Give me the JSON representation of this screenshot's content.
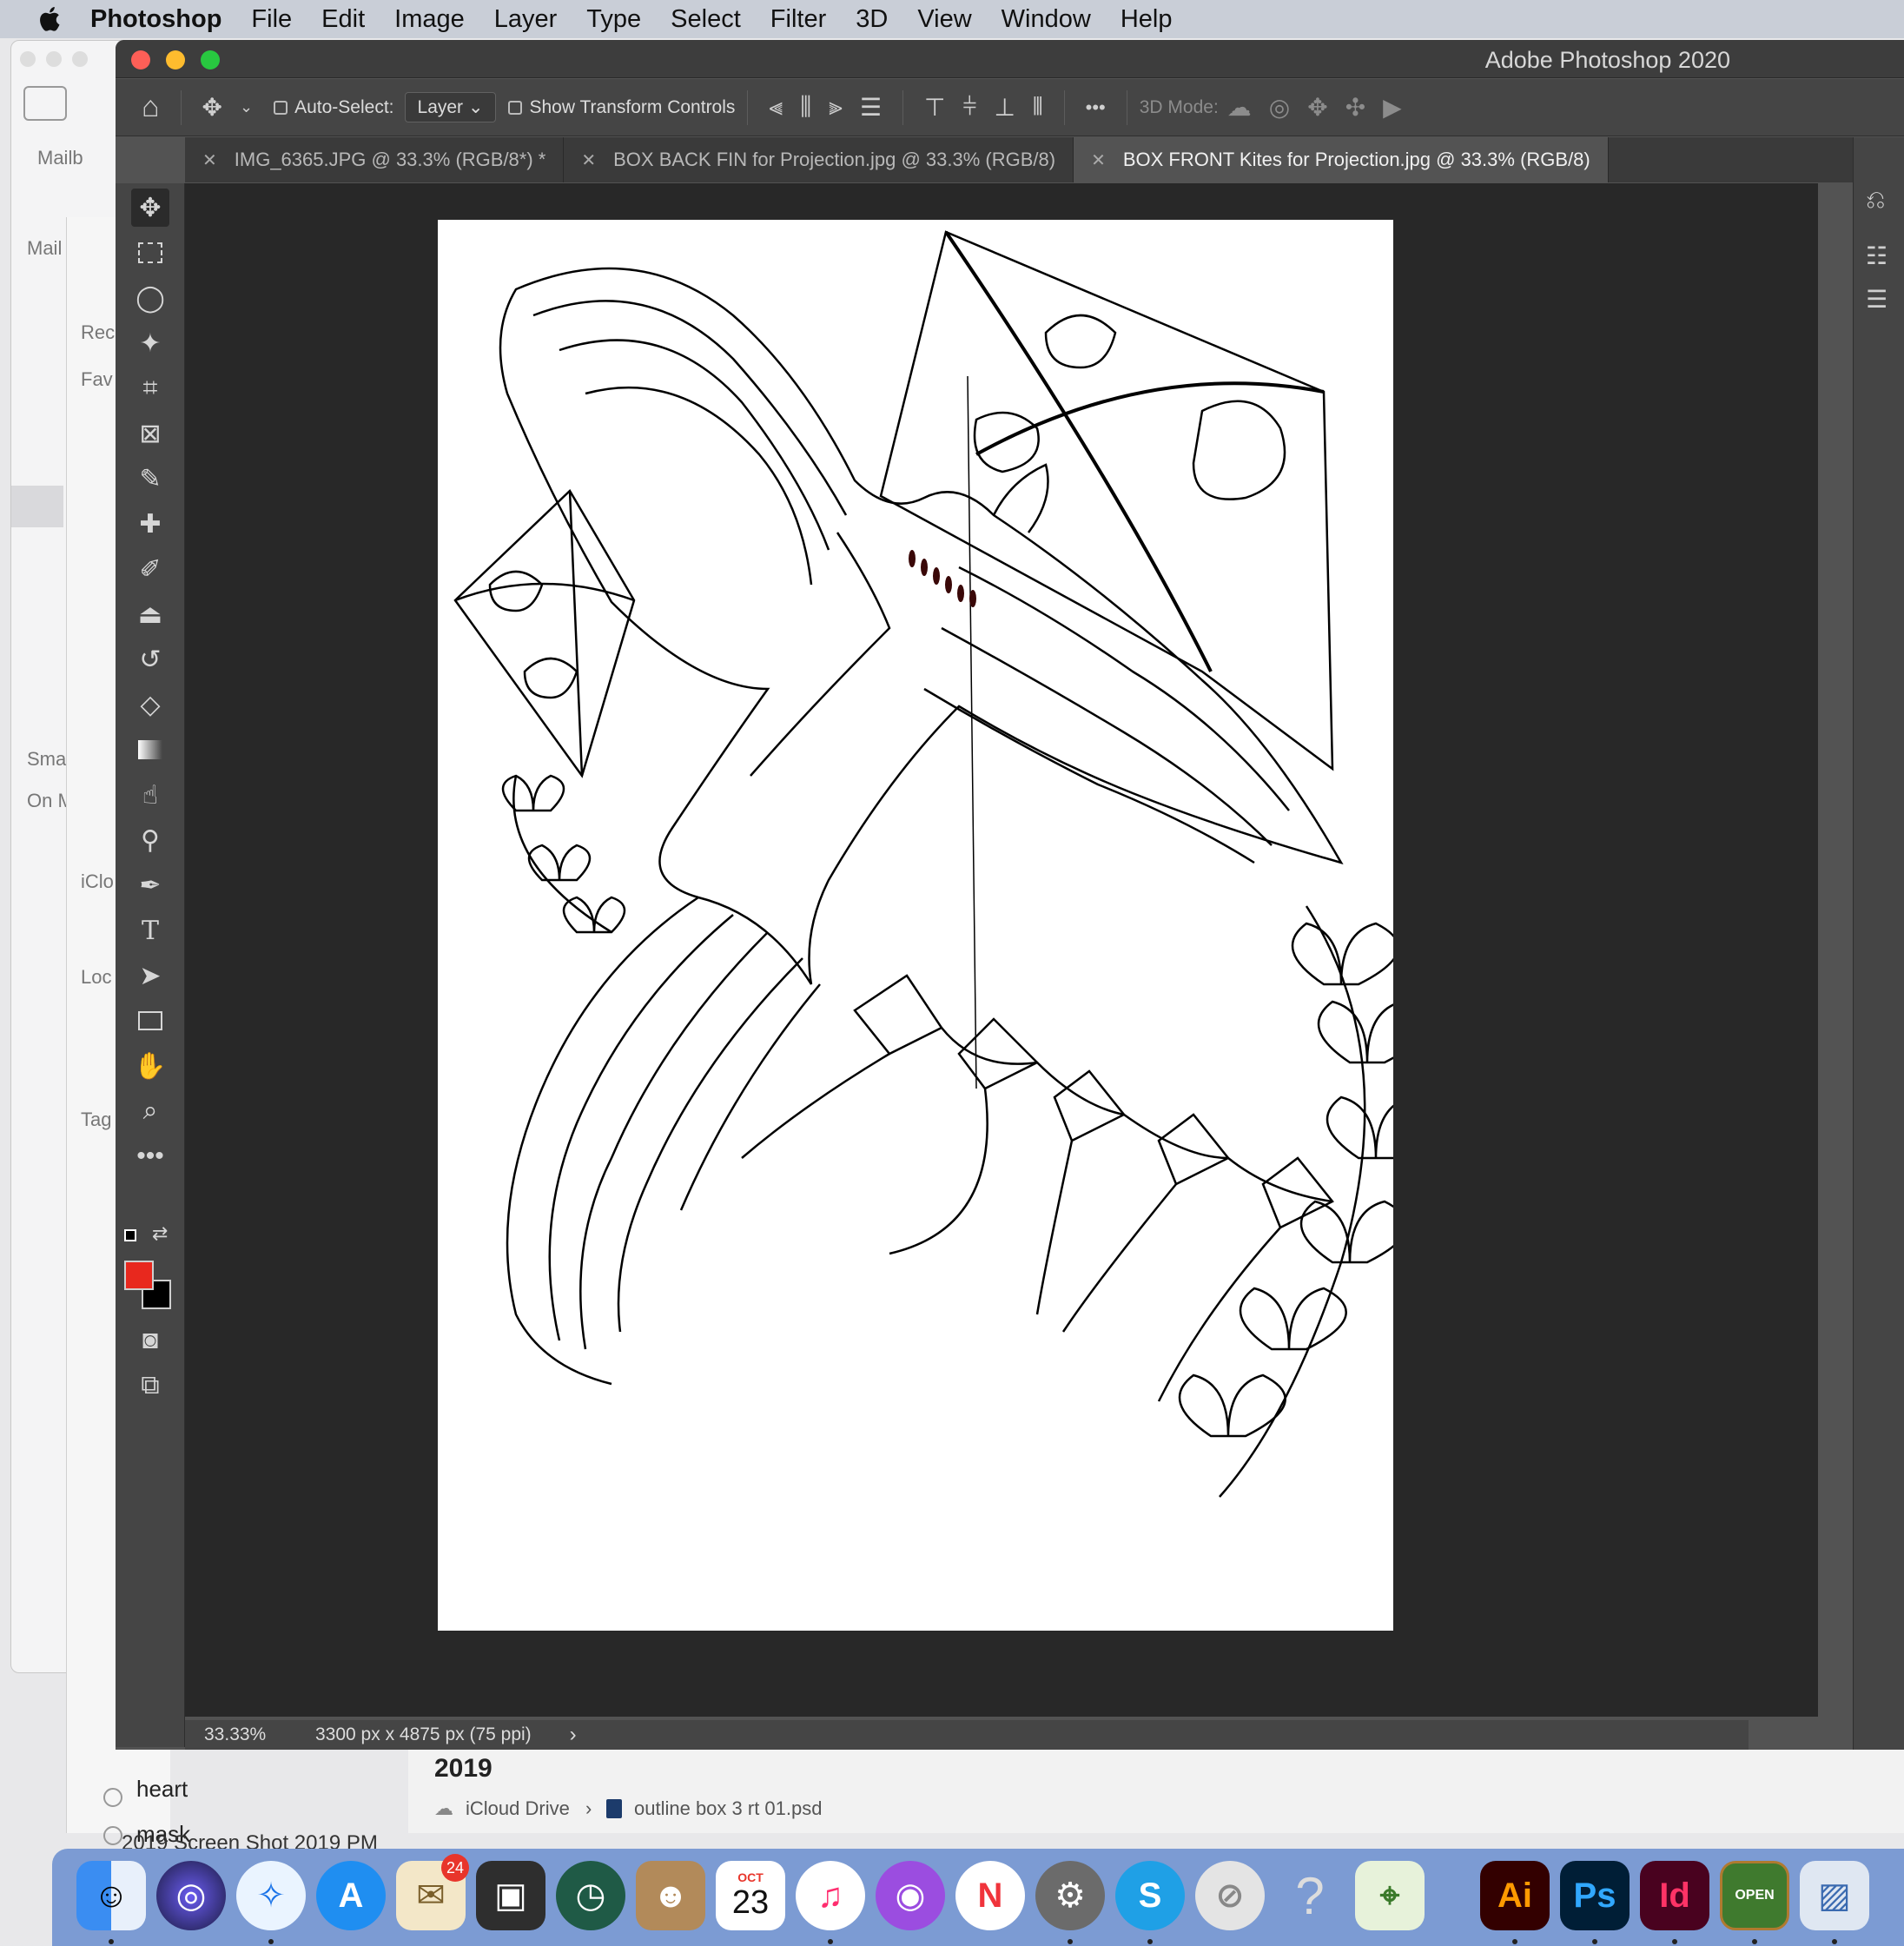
{
  "menubar": {
    "app": "Photoshop",
    "items": [
      "File",
      "Edit",
      "Image",
      "Layer",
      "Type",
      "Select",
      "Filter",
      "3D",
      "View",
      "Window",
      "Help"
    ]
  },
  "mail_sidebar": {
    "labels": [
      "Mailb",
      "Mail",
      "Rec",
      "Fav",
      "Sma",
      "On M",
      "iClo",
      "Loc",
      "Tag"
    ],
    "tags": [
      "heart",
      "mask"
    ],
    "year_label": "2019",
    "footer_overlap": "2019 Screen Shot 2019 PM"
  },
  "finder_path": {
    "root": "iCloud Drive",
    "separator": "›",
    "file": "outline box 3 rt 01.psd"
  },
  "window": {
    "title": "Adobe Photoshop 2020",
    "colors": {
      "close": "#fe5f57",
      "minimize": "#febc2e",
      "zoom": "#28c840"
    }
  },
  "options_bar": {
    "auto_select_label": "Auto-Select:",
    "auto_select_value": "Layer",
    "show_transform_label": "Show Transform Controls",
    "more_label": "•••",
    "mode_3d_label": "3D Mode:"
  },
  "tabs": [
    {
      "label": "IMG_6365.JPG @ 33.3% (RGB/8*) *",
      "active": false
    },
    {
      "label": "BOX BACK FIN for Projection.jpg @ 33.3% (RGB/8)",
      "active": false
    },
    {
      "label": "BOX FRONT Kites for Projection.jpg @ 33.3% (RGB/8)",
      "active": true
    }
  ],
  "tools": [
    "move-tool",
    "marquee-tool",
    "lasso-tool",
    "magic-wand-tool",
    "crop-tool",
    "frame-tool",
    "eyedropper-tool",
    "healing-tool",
    "brush-tool",
    "stamp-tool",
    "history-brush-tool",
    "eraser-tool",
    "gradient-tool",
    "smudge-tool",
    "dodge-tool",
    "pen-tool",
    "type-tool",
    "path-select-tool",
    "rectangle-tool",
    "hand-tool",
    "zoom-tool",
    "more-tools"
  ],
  "colors": {
    "foreground": "#e8281e",
    "background": "#000000"
  },
  "status": {
    "zoom": "33.33%",
    "doc_size": "3300 px x 4875 px (75 ppi)",
    "arrow": "›"
  },
  "dock": {
    "badge_mail": "24",
    "calendar_month": "OCT",
    "calendar_day": "23",
    "ai_label": "Ai",
    "ps_label": "Ps",
    "id_label": "Id",
    "open_sign": "OPEN",
    "question": "?"
  }
}
